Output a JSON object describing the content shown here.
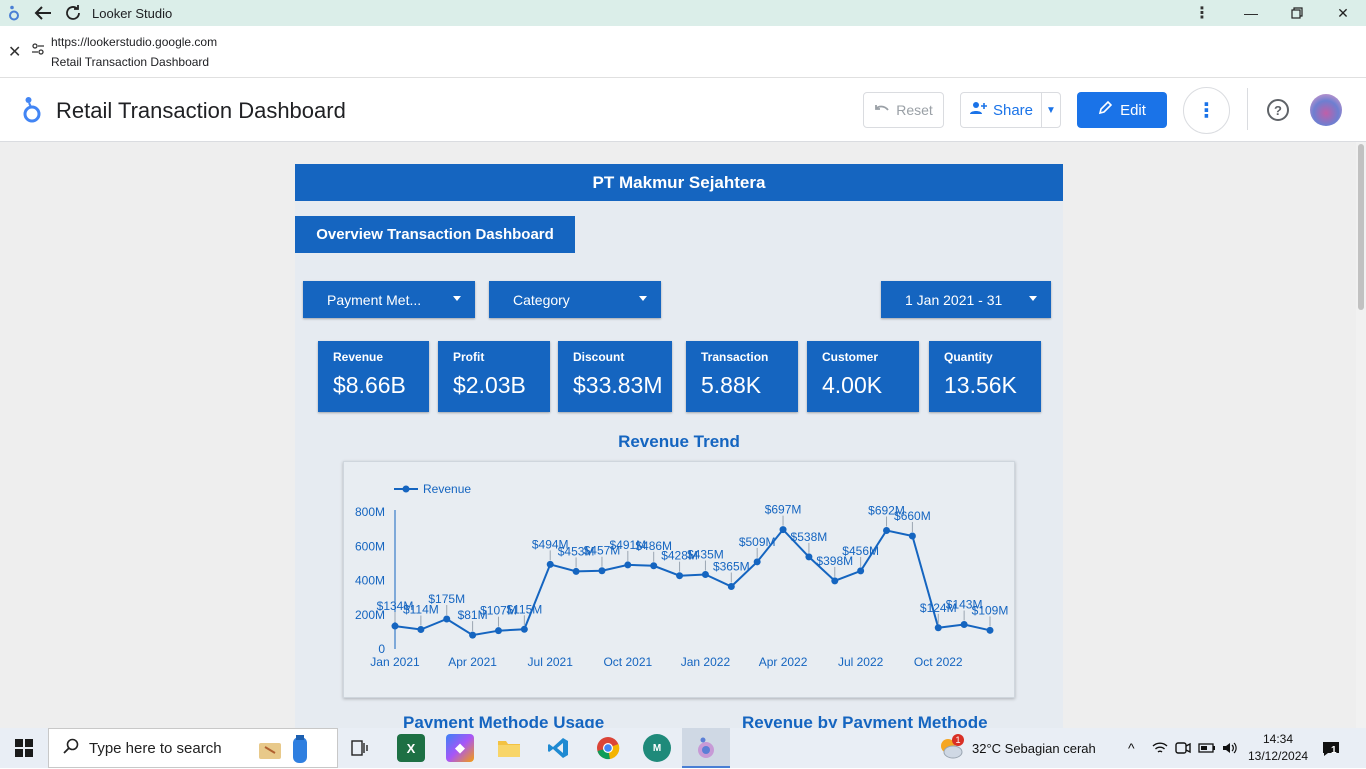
{
  "window": {
    "title": "Looker Studio"
  },
  "address": {
    "url": "https://lookerstudio.google.com",
    "page_title": "Retail Transaction Dashboard"
  },
  "header": {
    "doc_title": "Retail Transaction Dashboard",
    "reset_label": "Reset",
    "share_label": "Share",
    "edit_label": "Edit"
  },
  "report": {
    "company": "PT Makmur Sejahtera",
    "subtitle": "Overview Transaction Dashboard",
    "filters": {
      "payment": "Payment Met...",
      "category": "Category",
      "date": "1 Jan 2021 - 31"
    },
    "kpis": [
      {
        "label": "Revenue",
        "value": "$8.66B"
      },
      {
        "label": "Profit",
        "value": "$2.03B"
      },
      {
        "label": "Discount",
        "value": "$33.83M"
      },
      {
        "label": "Transaction",
        "value": "5.88K"
      },
      {
        "label": "Customer",
        "value": "4.00K"
      },
      {
        "label": "Quantity",
        "value": "13.56K"
      }
    ],
    "chart_title": "Revenue Trend",
    "bottom_titles": [
      "Payment Methode Usage",
      "Revenue by Payment Methode"
    ]
  },
  "chart_data": {
    "type": "line",
    "title": "Revenue Trend",
    "x": [
      "2021-01",
      "2021-02",
      "2021-03",
      "2021-04",
      "2021-05",
      "2021-06",
      "2021-07",
      "2021-08",
      "2021-09",
      "2021-10",
      "2021-11",
      "2021-12",
      "2022-01",
      "2022-02",
      "2022-03",
      "2022-04",
      "2022-05",
      "2022-06",
      "2022-07",
      "2022-08",
      "2022-09",
      "2022-10",
      "2022-11",
      "2022-12"
    ],
    "xticks": [
      "Jan 2021",
      "Apr 2021",
      "Jul 2021",
      "Oct 2021",
      "Jan 2022",
      "Apr 2022",
      "Jul 2022",
      "Oct 2022"
    ],
    "yticks": [
      "0",
      "200M",
      "400M",
      "600M",
      "800M"
    ],
    "ylim": [
      0,
      800
    ],
    "yunit": "M",
    "series": [
      {
        "name": "Revenue",
        "color": "#1565c0",
        "values": [
          134,
          114,
          175,
          81,
          107,
          115,
          494,
          453,
          457,
          491,
          486,
          428,
          435,
          365,
          509,
          697,
          538,
          398,
          456,
          692,
          660,
          124,
          143,
          109
        ],
        "labels": [
          "$134M",
          "$114M",
          "$175M",
          "$81M",
          "$107M",
          "$115M",
          "$494M",
          "$453M",
          "$457M",
          "$491M",
          "$486M",
          "$428M",
          "$435M",
          "$365M",
          "$509M",
          "$697M",
          "$538M",
          "$398M",
          "$456M",
          "$692M",
          "$660M",
          "$124M",
          "$143M",
          "$109M"
        ]
      }
    ],
    "legend": "top-left"
  },
  "taskbar": {
    "search_placeholder": "Type here to search",
    "weather": "32°C  Sebagian cerah",
    "weather_badge": "1",
    "time": "14:34",
    "date": "13/12/2024",
    "notif_count": "1",
    "apps": [
      "file-explorer",
      "excel",
      "copilot",
      "folder",
      "vscode",
      "chrome",
      "mymoney",
      "looker"
    ]
  }
}
